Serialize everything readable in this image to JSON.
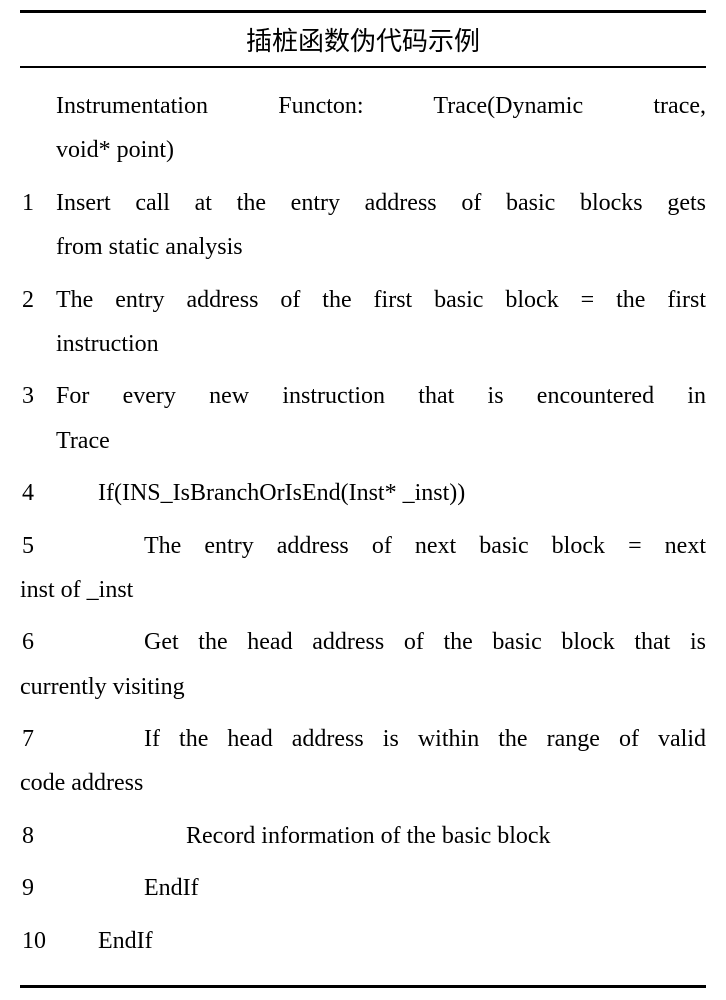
{
  "title": "插桩函数伪代码示例",
  "header": {
    "line1": "Instrumentation Functon: Trace(Dynamic trace,",
    "line2": "void* point)"
  },
  "lines": [
    {
      "num": "1",
      "segments": [
        {
          "text": "Insert call at the entry address of basic blocks gets",
          "cls": "justify-full"
        },
        {
          "text": "from static analysis",
          "cls": ""
        }
      ]
    },
    {
      "num": "2",
      "segments": [
        {
          "text": "The entry address of the first basic block = the first",
          "cls": "justify-full"
        },
        {
          "text": "instruction",
          "cls": ""
        }
      ]
    },
    {
      "num": "3",
      "segments": [
        {
          "text": "For every new instruction that is encountered in",
          "cls": "justify-full"
        },
        {
          "text": "Trace",
          "cls": ""
        }
      ]
    },
    {
      "num": "4",
      "segments": [
        {
          "text": "If(INS_IsBranchOrIsEnd(Inst* _inst))",
          "cls": "indent-1"
        }
      ]
    },
    {
      "num": "5",
      "segments": [
        {
          "text": "The entry address of next basic block = next",
          "cls": "indent-2 justify-full"
        },
        {
          "text": "inst of _inst",
          "cls": "",
          "noindent": true
        }
      ]
    },
    {
      "num": "6",
      "segments": [
        {
          "text": "Get the head address of the basic block that is",
          "cls": "indent-2 justify-full"
        },
        {
          "text": "currently visiting",
          "cls": "",
          "noindent": true
        }
      ]
    },
    {
      "num": "7",
      "segments": [
        {
          "text": "If the head address is within the range of valid",
          "cls": "indent-2 justify-full"
        },
        {
          "text": "code address",
          "cls": "",
          "noindent": true
        }
      ]
    },
    {
      "num": "8",
      "segments": [
        {
          "text": "Record information of the basic block",
          "cls": "indent-3"
        }
      ]
    },
    {
      "num": "9",
      "segments": [
        {
          "text": "EndIf",
          "cls": "indent-2"
        }
      ]
    },
    {
      "num": "10",
      "segments": [
        {
          "text": "EndIf",
          "cls": "indent-1"
        }
      ]
    }
  ]
}
